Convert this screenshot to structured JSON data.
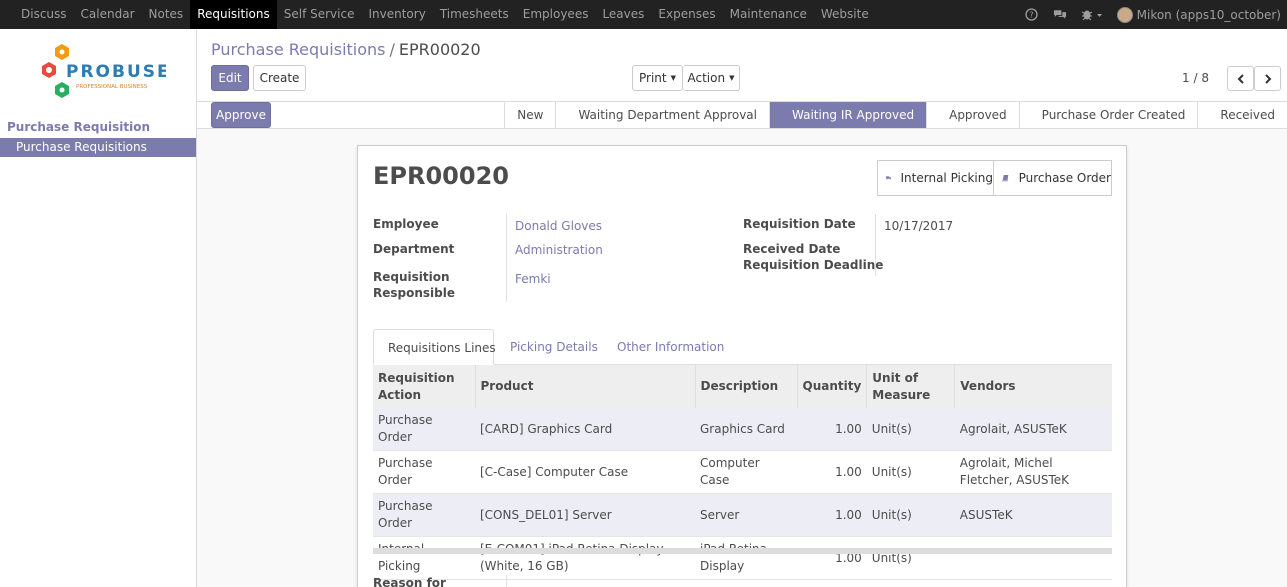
{
  "topnav": {
    "menu": [
      {
        "label": "Discuss"
      },
      {
        "label": "Calendar"
      },
      {
        "label": "Notes"
      },
      {
        "label": "Requisitions",
        "active": true
      },
      {
        "label": "Self Service"
      },
      {
        "label": "Inventory"
      },
      {
        "label": "Timesheets"
      },
      {
        "label": "Employees"
      },
      {
        "label": "Leaves"
      },
      {
        "label": "Expenses"
      },
      {
        "label": "Maintenance"
      },
      {
        "label": "Website"
      }
    ],
    "user_label": "Mikon (apps10_october)"
  },
  "sidebar": {
    "logo_text": "PROBUSE",
    "logo_sub": "PROFESSIONAL BUSINESS",
    "heading": "Purchase Requisition",
    "item": "Purchase Requisitions"
  },
  "control": {
    "breadcrumb_parent": "Purchase Requisitions",
    "breadcrumb_sep": "/",
    "breadcrumb_current": "EPR00020",
    "edit_label": "Edit",
    "create_label": "Create",
    "print_label": "Print",
    "action_label": "Action",
    "pager": "1 / 8"
  },
  "statusbar": {
    "approve_label": "Approve",
    "stages": [
      "New",
      "Waiting Department Approval",
      "Waiting IR Approved",
      "Approved",
      "Purchase Order Created",
      "Received"
    ],
    "active_stage": "Waiting IR Approved"
  },
  "form": {
    "title": "EPR00020",
    "smart_buttons": {
      "picking": "Internal Picking",
      "purchase": "Purchase Order"
    },
    "employee_label": "Employee",
    "employee": "Donald Gloves",
    "department_label": "Department",
    "department": "Administration",
    "responsible_label_1": "Requisition",
    "responsible_label_2": "Responsible",
    "responsible": "Femki",
    "req_date_label": "Requisition Date",
    "req_date": "10/17/2017",
    "received_date_label": "Received Date",
    "deadline_label": "Requisition Deadline",
    "reason_label": "Reason for"
  },
  "tabs": [
    "Requisitions Lines",
    "Picking Details",
    "Other Information"
  ],
  "lines": {
    "headers": [
      "Requisition Action",
      "Product",
      "Description",
      "Quantity",
      "Unit of Measure",
      "Vendors"
    ],
    "rows": [
      {
        "action": "Purchase Order",
        "product": "[CARD] Graphics Card",
        "description": "Graphics Card",
        "qty": "1.00",
        "uom": "Unit(s)",
        "vendors": "Agrolait, ASUSTeK"
      },
      {
        "action": "Purchase Order",
        "product": "[C-Case] Computer Case",
        "description": "Computer Case",
        "qty": "1.00",
        "uom": "Unit(s)",
        "vendors": "Agrolait, Michel Fletcher, ASUSTeK"
      },
      {
        "action": "Purchase Order",
        "product": "[CONS_DEL01] Server",
        "description": "Server",
        "qty": "1.00",
        "uom": "Unit(s)",
        "vendors": "ASUSTeK"
      },
      {
        "action": "Internal Picking",
        "product": "[E-COM01] iPad Retina Display (White, 16 GB)",
        "description": "iPad Retina Display",
        "qty": "1.00",
        "uom": "Unit(s)",
        "vendors": ""
      }
    ]
  },
  "colors": {
    "accent": "#7c7bad",
    "nav_bg": "#222222"
  }
}
